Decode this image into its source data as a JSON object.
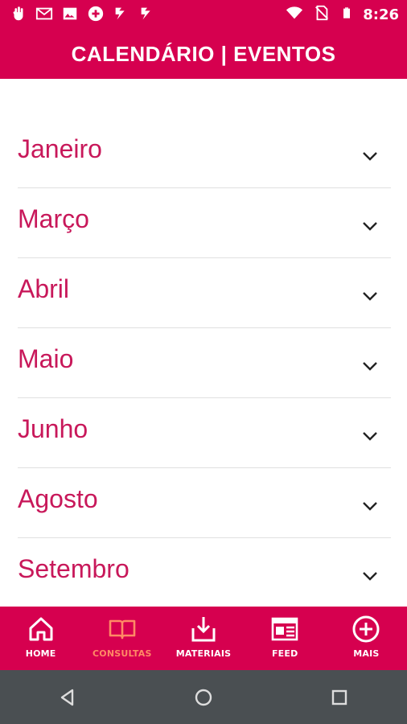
{
  "status_bar": {
    "time": "8:26",
    "icons_left": [
      "hand-icon",
      "gmail-icon",
      "image-icon",
      "plus-badge-icon",
      "check-app-icon",
      "check-app-icon-2"
    ],
    "icons_right": [
      "wifi-icon",
      "no-sim-icon",
      "battery-icon"
    ]
  },
  "header": {
    "title": "CALENDÁRIO | EVENTOS"
  },
  "months": [
    {
      "label": "Janeiro"
    },
    {
      "label": "Março"
    },
    {
      "label": "Abril"
    },
    {
      "label": "Maio"
    },
    {
      "label": "Junho"
    },
    {
      "label": "Agosto"
    },
    {
      "label": "Setembro"
    }
  ],
  "bottom_nav": [
    {
      "label": "HOME",
      "icon": "home-icon",
      "active": false
    },
    {
      "label": "CONSULTAS",
      "icon": "book-icon",
      "active": true
    },
    {
      "label": "MATERIAIS",
      "icon": "download-icon",
      "active": false
    },
    {
      "label": "FEED",
      "icon": "news-icon",
      "active": false
    },
    {
      "label": "MAIS",
      "icon": "plus-circle-icon",
      "active": false
    }
  ],
  "colors": {
    "brand": "#d6004f",
    "month_text": "#c8185a",
    "active_nav": "#ff8a65",
    "android_nav": "#4a4f52"
  }
}
